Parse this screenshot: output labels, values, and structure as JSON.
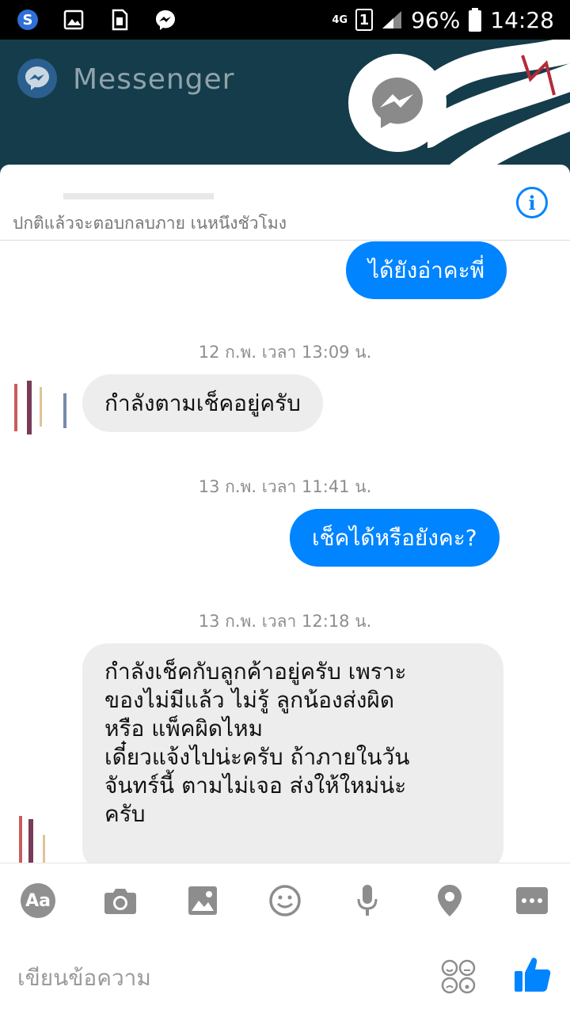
{
  "status_bar": {
    "network": "4G",
    "sim": "1",
    "battery": "96%",
    "time": "14:28"
  },
  "background": {
    "app_title": "Messenger"
  },
  "chat": {
    "subtitle": "ปกติแล้วจะตอบกลบภาย เนหนึงชัวโมง",
    "messages": [
      {
        "kind": "outgoing",
        "text": "ได้ยังอ่าคะพี่"
      },
      {
        "kind": "timestamp",
        "text": "12 ก.พ. เวลา 13:09 น."
      },
      {
        "kind": "incoming",
        "text": "กำลังตามเช็คอยู่ครับ"
      },
      {
        "kind": "timestamp",
        "text": "13 ก.พ. เวลา 11:41 น."
      },
      {
        "kind": "outgoing",
        "text": "เช็คได้หรือยังคะ?"
      },
      {
        "kind": "timestamp",
        "text": "13 ก.พ. เวลา 12:18 น."
      },
      {
        "kind": "incoming",
        "lines": [
          "กำลังเช็คกับลูกค้าอยู่ครับ เพราะ",
          "ของไม่มีแล้ว ไม่รู้ ลูกน้องส่งผิด",
          "หรือ แพ็คผิดไหม",
          "เดี๋ยวแจ้งไปน่ะครับ ถ้าภายในวัน",
          "จันทร์นี้ ตามไม่เจอ ส่งให้ใหม่น่ะ",
          "ครับ"
        ]
      }
    ]
  },
  "composer": {
    "aa_label": "Aa",
    "placeholder": "เขียนข้อความ"
  },
  "icons": {
    "toolbar": [
      "text-style-icon",
      "camera-icon",
      "image-icon",
      "emoji-icon",
      "microphone-icon",
      "location-icon",
      "more-icon"
    ],
    "accent": "#0084ff"
  }
}
